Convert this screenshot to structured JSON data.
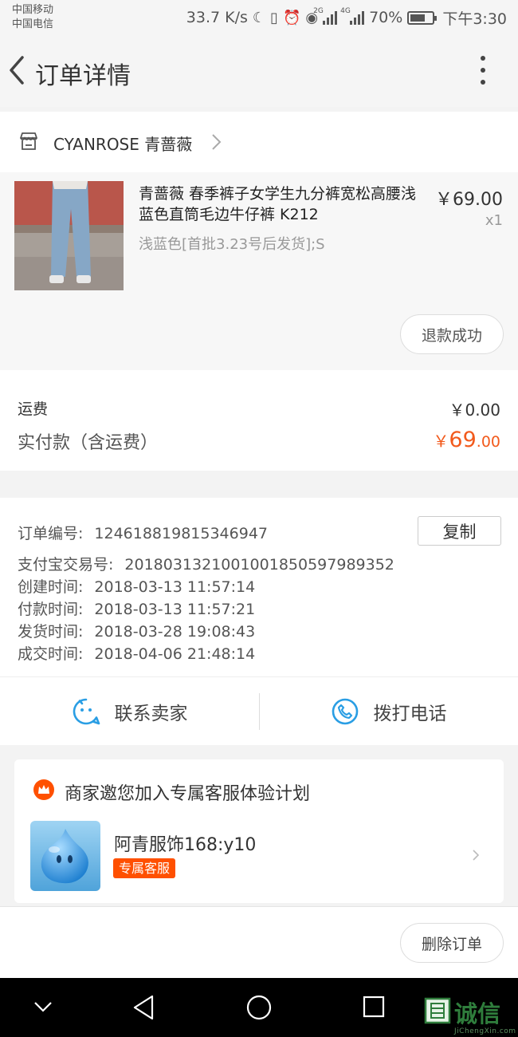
{
  "status_bar": {
    "carrier_1": "中国移动",
    "carrier_2": "中国电信",
    "speed": "33.7 K/s",
    "net_1": "2G",
    "net_2": "4G",
    "battery": "70%",
    "battery_level": 0.7,
    "time": "下午3:30"
  },
  "header": {
    "title": "订单详情"
  },
  "shop": {
    "name": "CYANROSE 青蔷薇"
  },
  "product": {
    "title": "青蔷薇 春季裤子女学生九分裤宽松高腰浅蓝色直筒毛边牛仔裤 K212",
    "sku": "浅蓝色[首批3.23号后发货];S",
    "price": "￥69.00",
    "quantity": "x1",
    "status_button": "退款成功"
  },
  "totals": {
    "shipping_label": "运费",
    "shipping_value": "￥0.00",
    "paid_label": "实付款（含运费）",
    "paid_currency": "￥",
    "paid_integer": "69",
    "paid_decimal": ".00"
  },
  "order_info": {
    "copy_button": "复制",
    "rows": [
      {
        "label": "订单编号:",
        "value": "124618819815346947"
      },
      {
        "label": "支付宝交易号:",
        "value": "2018031321001001850597989352"
      },
      {
        "label": "创建时间:",
        "value": "2018-03-13 11:57:14"
      },
      {
        "label": "付款时间:",
        "value": "2018-03-13 11:57:21"
      },
      {
        "label": "发货时间:",
        "value": "2018-03-28 19:08:43"
      },
      {
        "label": "成交时间:",
        "value": "2018-04-06 21:48:14"
      }
    ]
  },
  "contact": {
    "seller_label": "联系卖家",
    "phone_label": "拨打电话"
  },
  "promo": {
    "title": "商家邀您加入专属客服体验计划",
    "agent_name": "阿青服饰168:y10",
    "agent_badge": "专属客服"
  },
  "actions": {
    "delete_button": "删除订单"
  },
  "watermark": {
    "text": "诚信",
    "url": "JiChengXin.com"
  },
  "colors": {
    "accent_orange": "#f25a1c",
    "badge_orange": "#ff5000",
    "icon_blue": "#2a9ee4"
  }
}
